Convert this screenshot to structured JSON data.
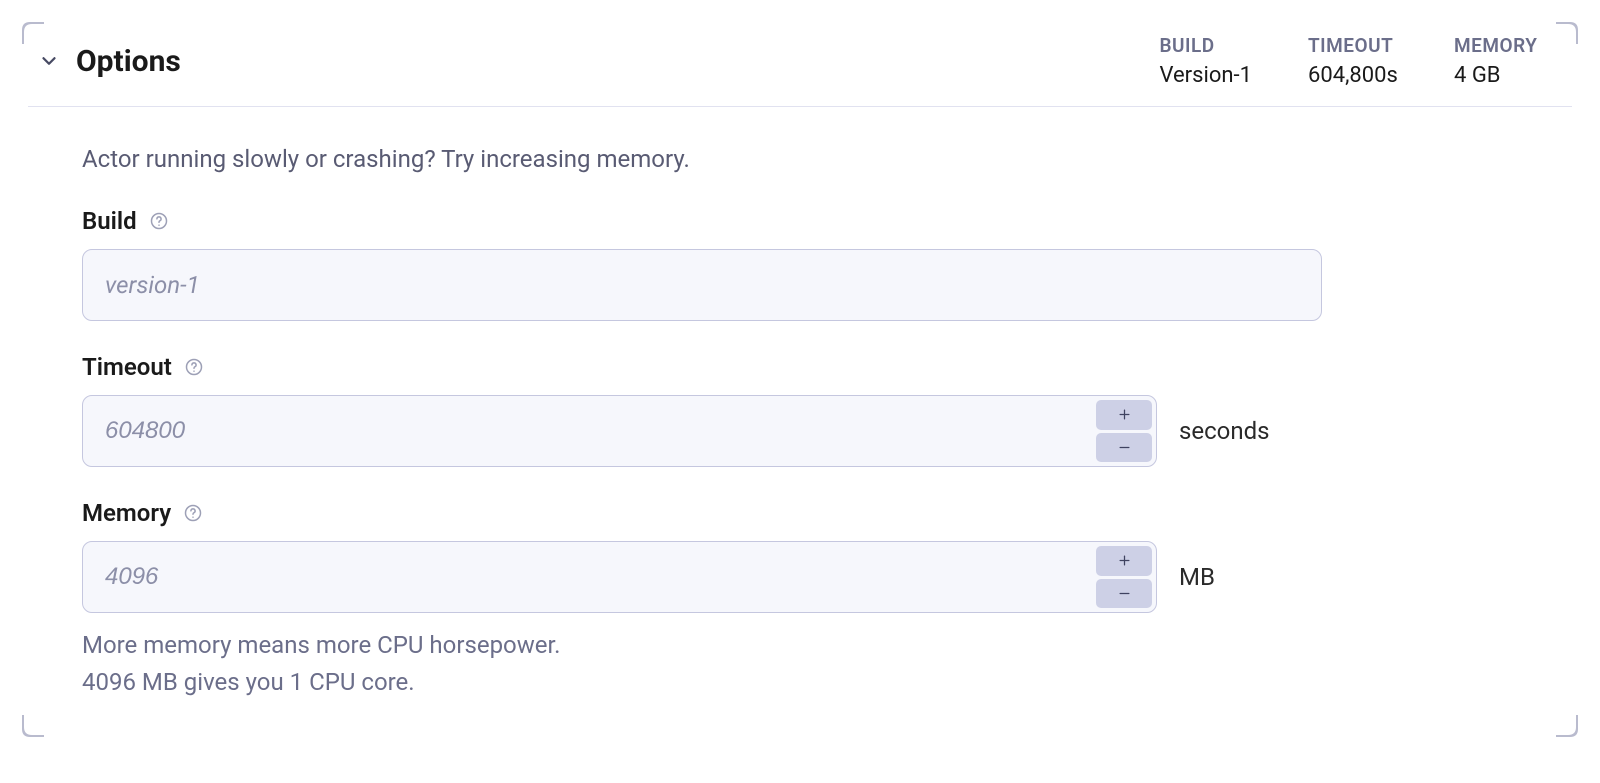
{
  "header": {
    "title": "Options",
    "summary": [
      {
        "label": "BUILD",
        "value": "Version-1"
      },
      {
        "label": "TIMEOUT",
        "value": "604,800s"
      },
      {
        "label": "MEMORY",
        "value": "4 GB"
      }
    ]
  },
  "hint": "Actor running slowly or crashing? Try increasing memory.",
  "fields": {
    "build": {
      "label": "Build",
      "value": "version-1"
    },
    "timeout": {
      "label": "Timeout",
      "value": "604800",
      "unit": "seconds"
    },
    "memory": {
      "label": "Memory",
      "value": "4096",
      "unit": "MB",
      "help_line1": "More memory means more CPU horsepower.",
      "help_line2": "4096 MB gives you 1 CPU core."
    }
  }
}
